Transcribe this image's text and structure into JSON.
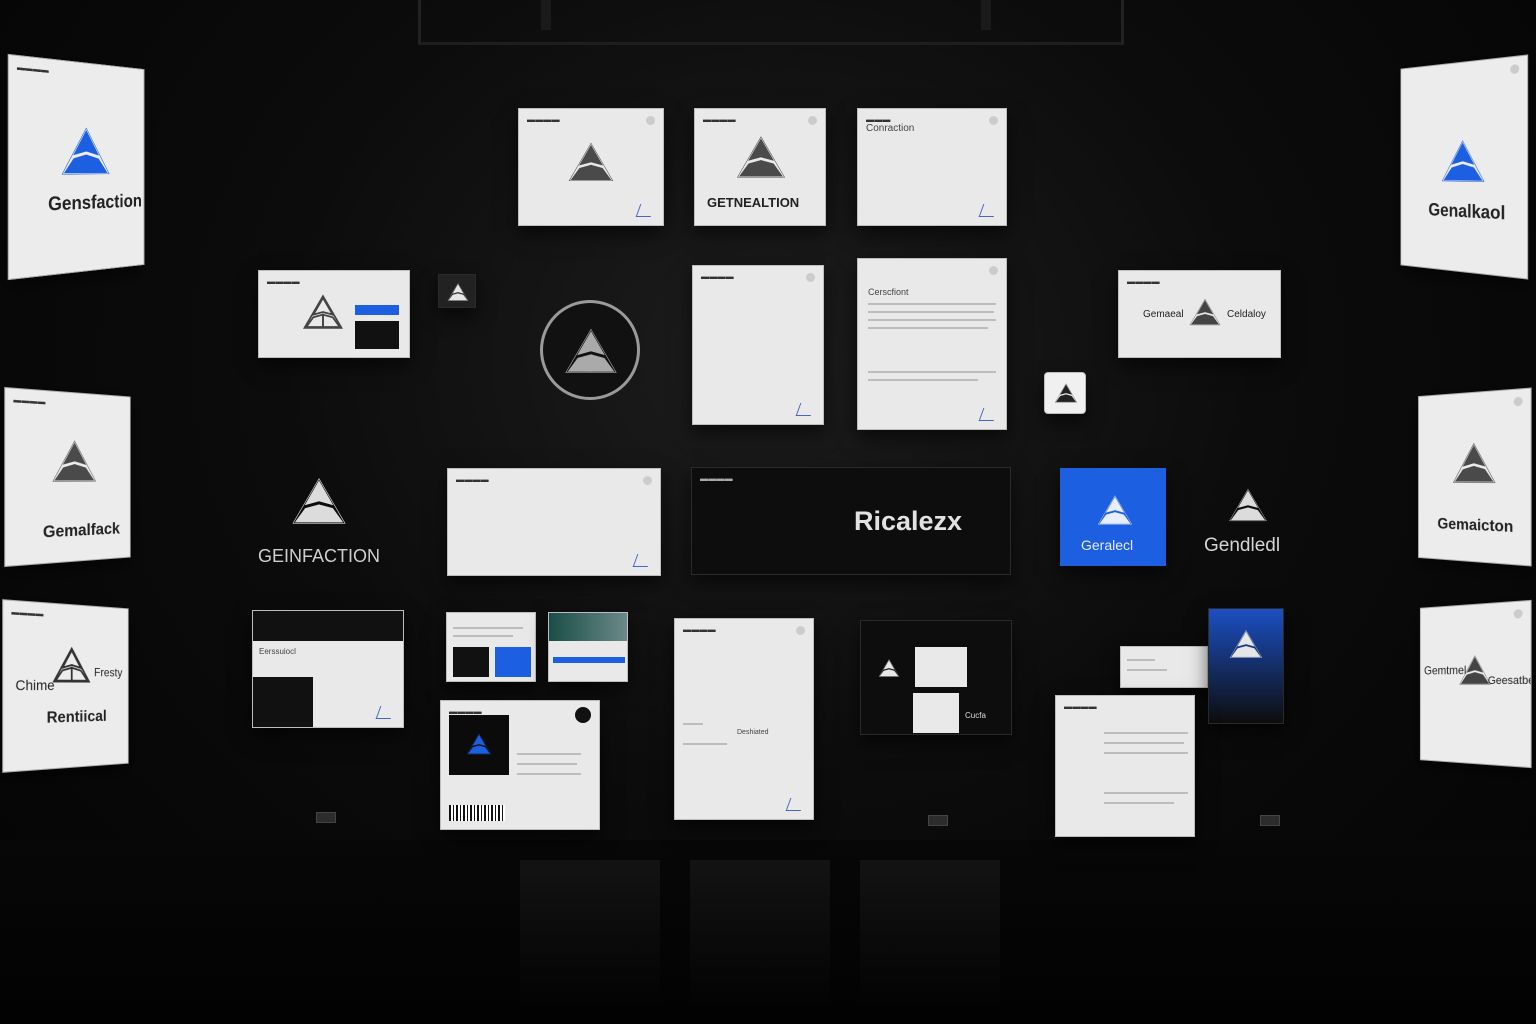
{
  "colors": {
    "accent_blue": "#1c5fe0",
    "background": "#050505",
    "panel": "#e9e9e9"
  },
  "icons": {
    "brand_mark": "geometric-brand-mark-icon"
  },
  "side_left": {
    "top": "Gensfaction",
    "middle": "Gemalfack",
    "bottom_a": "Chime",
    "bottom_b": "Fresty",
    "bottom_c": "Rentiical"
  },
  "side_right": {
    "top": "Genalkaol",
    "middle": "Gemaicton",
    "bottom_a": "Gemtmel",
    "bottom_b": "Geesatbel"
  },
  "row1": {
    "box2": "GETNEALTION",
    "box3": "Conraction"
  },
  "row2": {
    "letter": "Cerscfiont",
    "card_left": "Gemaeal",
    "card_right": "Celdaloy"
  },
  "row3": {
    "logo_caption": "GEINFACTION",
    "dark_banner": "Ricalezx",
    "blue_tile": "Geralecl",
    "right_caption": "Gendledl"
  },
  "row4": {
    "doc_a": "Eerssuiocl",
    "doc_b": "Deshiated",
    "dark_card": "Cucfa"
  }
}
